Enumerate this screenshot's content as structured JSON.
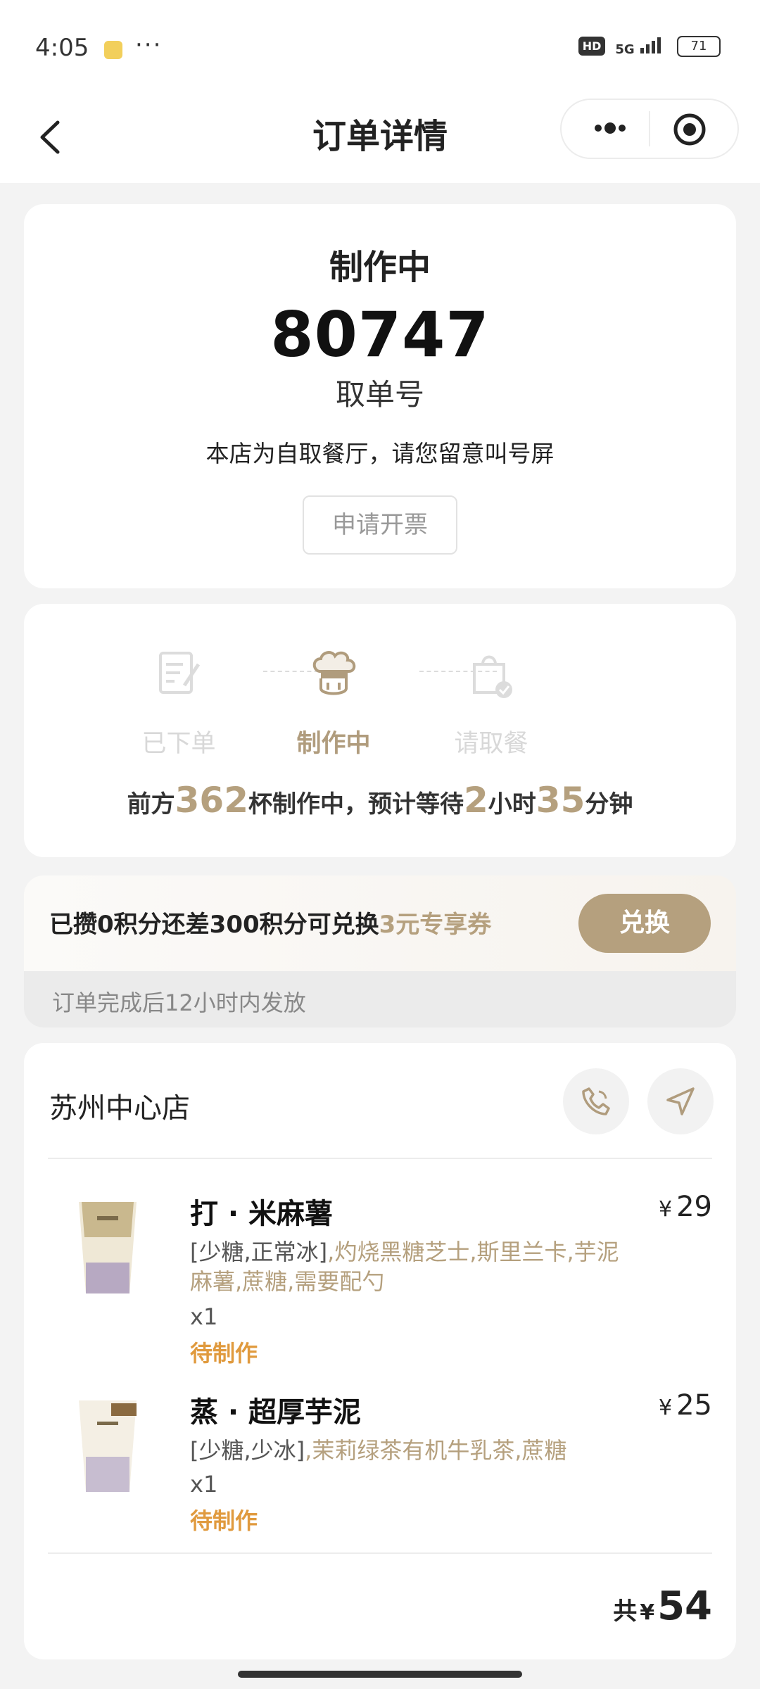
{
  "status_bar": {
    "time": "4:05",
    "dots": "···",
    "hd": "HD",
    "network": "5G",
    "battery": "71"
  },
  "header": {
    "title": "订单详情"
  },
  "order": {
    "status": "制作中",
    "pickup_number": "80747",
    "pickup_label": "取单号",
    "notice": "本店为自取餐厅，请您留意叫号屏",
    "invoice_button": "申请开票"
  },
  "progress": {
    "steps": [
      {
        "label": "已下单",
        "icon": "order-placed-icon"
      },
      {
        "label": "制作中",
        "icon": "chef-hat-icon"
      },
      {
        "label": "请取餐",
        "icon": "pickup-bag-icon"
      }
    ],
    "current_step": 2,
    "wait": {
      "prefix": "前方",
      "cups": "362",
      "middle": "杯制作中，预计等待",
      "hours": "2",
      "hours_unit": "小时",
      "minutes": "35",
      "minutes_unit": "分钟"
    }
  },
  "points": {
    "text": "已攒0积分还差300积分可兑换",
    "highlight": "3元专享券",
    "button": "兑换",
    "footer": "订单完成后12小时内发放"
  },
  "store": {
    "name": "苏州中心店",
    "phone_icon": "phone-icon",
    "navigate_icon": "navigation-arrow-icon"
  },
  "items": [
    {
      "name": "打 · 米麻薯",
      "price_symbol": "¥",
      "price": "29",
      "spec_base": "[少糖,正常冰]",
      "spec_options": ",灼烧黑糖芝士,斯里兰卡,芋泥麻薯,蔗糖,需要配勺",
      "qty": "x1",
      "state": "待制作"
    },
    {
      "name": "蒸 · 超厚芋泥",
      "price_symbol": "¥",
      "price": "25",
      "spec_base": "[少糖,少冰]",
      "spec_options": ",茉莉绿茶有机牛乳茶,蔗糖",
      "qty": "x1",
      "state": "待制作"
    }
  ],
  "total": {
    "label": "共",
    "symbol": "¥",
    "amount": "54"
  },
  "colors": {
    "accent": "#b5a07e",
    "pending": "#e09a3e",
    "inactive": "#d8d8d8"
  }
}
